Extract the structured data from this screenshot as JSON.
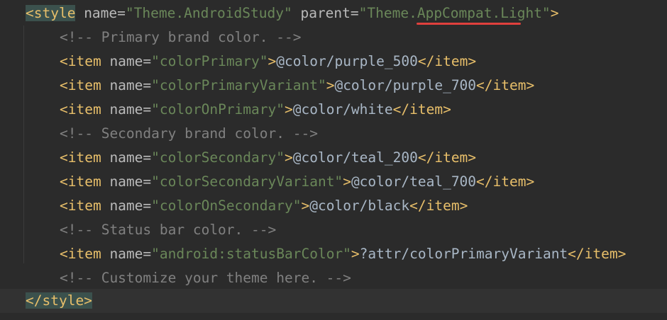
{
  "style_open": {
    "lt": "<",
    "tag": "style",
    "attr1": " name",
    "eq1": "=",
    "val1": "\"Theme.AndroidStudy\"",
    "attr2": " parent",
    "eq2": "=",
    "val2": "\"Theme.AppCompat.Light\"",
    "gt": ">"
  },
  "lines": [
    {
      "comment": "<!-- Primary brand color. -->"
    },
    {
      "open": "<item",
      "attr": " name",
      "eq": "=",
      "val": "\"colorPrimary\"",
      "gt": ">",
      "text": "@color/purple_500",
      "close": "</item>"
    },
    {
      "open": "<item",
      "attr": " name",
      "eq": "=",
      "val": "\"colorPrimaryVariant\"",
      "gt": ">",
      "text": "@color/purple_700",
      "close": "</item>"
    },
    {
      "open": "<item",
      "attr": " name",
      "eq": "=",
      "val": "\"colorOnPrimary\"",
      "gt": ">",
      "text": "@color/white",
      "close": "</item>"
    },
    {
      "comment": "<!-- Secondary brand color. -->"
    },
    {
      "open": "<item",
      "attr": " name",
      "eq": "=",
      "val": "\"colorSecondary\"",
      "gt": ">",
      "text": "@color/teal_200",
      "close": "</item>"
    },
    {
      "open": "<item",
      "attr": " name",
      "eq": "=",
      "val": "\"colorSecondaryVariant\"",
      "gt": ">",
      "text": "@color/teal_700",
      "close": "</item>"
    },
    {
      "open": "<item",
      "attr": " name",
      "eq": "=",
      "val": "\"colorOnSecondary\"",
      "gt": ">",
      "text": "@color/black",
      "close": "</item>"
    },
    {
      "comment": "<!-- Status bar color. -->"
    },
    {
      "open": "<item",
      "attr": " name",
      "eq": "=",
      "val": "\"android:statusBarColor\"",
      "gt": ">",
      "text": "?attr/colorPrimaryVariant",
      "close": "</item>"
    },
    {
      "comment": "<!-- Customize your theme here. -->"
    }
  ],
  "style_close": "</style>",
  "colors": {
    "background": "#2b2b2b",
    "tag": "#e8bf6a",
    "attribute": "#bababa",
    "value": "#6a8759",
    "comment": "#808080",
    "error_underline": "#e0403d"
  }
}
